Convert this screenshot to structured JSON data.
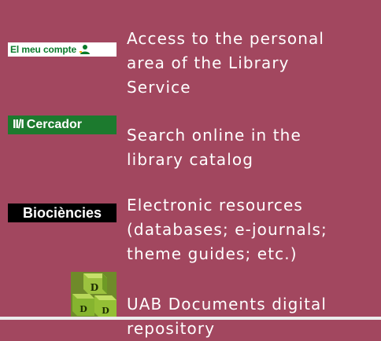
{
  "items": [
    {
      "icon_label": "El meu compte",
      "description": "Access to the personal\narea of the Library\nService"
    },
    {
      "icon_label_mark": "II/I",
      "icon_label": "Cercador",
      "description": "Search online in the\nlibrary catalog"
    },
    {
      "icon_label": "Biociències",
      "description": "Electronic resources\n(databases; e-journals;\ntheme guides; etc.)"
    },
    {
      "icon_letters": [
        "D",
        "D",
        "D"
      ],
      "description": "UAB Documents digital\nrepository"
    }
  ],
  "colors": {
    "background": "#a2475f",
    "text": "#ffffff",
    "green": "#1c7a2e",
    "black": "#000000"
  }
}
